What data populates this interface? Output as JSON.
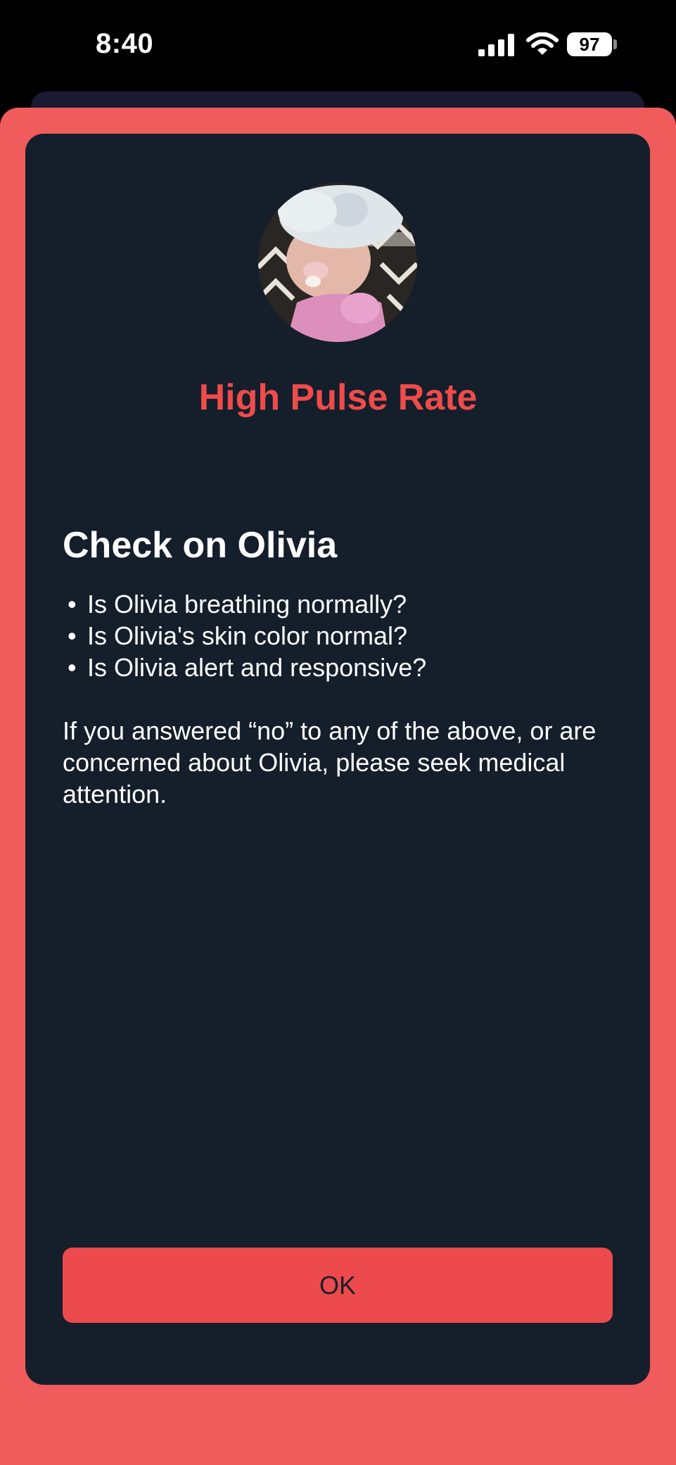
{
  "status_bar": {
    "time": "8:40",
    "battery_level": "97",
    "icons": [
      "signal-icon",
      "wifi-icon",
      "battery-icon"
    ]
  },
  "alert": {
    "title": "High Pulse Rate",
    "heading": "Check on Olivia",
    "questions": [
      "Is Olivia breathing normally?",
      "Is Olivia's skin color normal?",
      "Is Olivia alert and responsive?"
    ],
    "bullet": "•",
    "advice": "If you answered “no” to any of the above, or are concerned about Olivia, please seek medical attention.",
    "ok_label": "OK"
  },
  "colors": {
    "sheet_background": "#f05b5b",
    "card_background": "#151e2b",
    "title_color": "#f04b4b",
    "button_background": "#ec4a4d",
    "text_color": "#ffffff"
  }
}
